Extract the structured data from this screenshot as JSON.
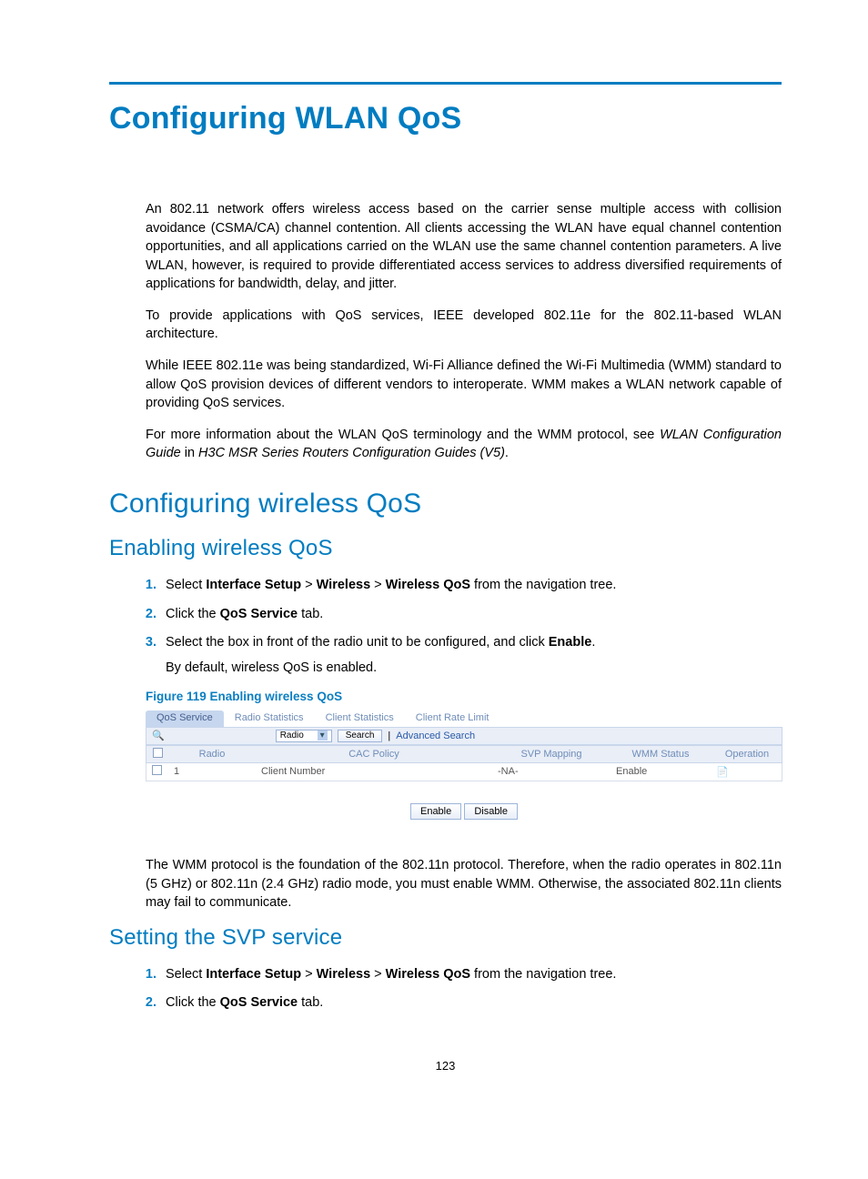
{
  "title": "Configuring WLAN QoS",
  "paragraphs": {
    "p1": "An 802.11 network offers wireless access based on the carrier sense multiple access with collision avoidance (CSMA/CA) channel contention. All clients accessing the WLAN have equal channel contention opportunities, and all applications carried on the WLAN use the same channel contention parameters. A live WLAN, however, is required to provide differentiated access services to address diversified requirements of applications for bandwidth, delay, and jitter.",
    "p2": "To provide applications with QoS services, IEEE developed 802.11e for the 802.11-based WLAN architecture.",
    "p3": "While IEEE 802.11e was being standardized, Wi-Fi Alliance defined the Wi-Fi Multimedia (WMM) standard to allow QoS provision devices of different vendors to interoperate. WMM makes a WLAN network capable of providing QoS services.",
    "p4a": "For more information about the WLAN QoS terminology and the WMM protocol, see ",
    "p4b": "WLAN Configuration Guide",
    "p4c": " in ",
    "p4d": "H3C MSR Series Routers Configuration Guides (V5)",
    "p4e": "."
  },
  "sections": {
    "config_wireless_qos": "Configuring wireless QoS",
    "enable_wireless_qos": "Enabling wireless QoS",
    "setting_svp": "Setting the SVP service"
  },
  "steps_enable": {
    "s1a": "Select ",
    "s1b": "Interface Setup",
    "s1c": " > ",
    "s1d": "Wireless",
    "s1e": " > ",
    "s1f": "Wireless QoS",
    "s1g": " from the navigation tree.",
    "s2a": "Click the ",
    "s2b": "QoS Service",
    "s2c": " tab.",
    "s3a": "Select the box in front of the radio unit to be configured, and click ",
    "s3b": "Enable",
    "s3c": ".",
    "s3_body": "By default, wireless QoS is enabled."
  },
  "figure_caption": "Figure 119 Enabling wireless QoS",
  "screenshot": {
    "tabs": [
      "QoS Service",
      "Radio Statistics",
      "Client Statistics",
      "Client Rate Limit"
    ],
    "search": {
      "field_value": "Radio",
      "button": "Search",
      "advanced": "Advanced Search"
    },
    "columns": [
      "",
      "Radio",
      "CAC Policy",
      "SVP Mapping",
      "WMM Status",
      "Operation"
    ],
    "row": {
      "radio": "1",
      "cac": "Client Number",
      "svp": "-NA-",
      "wmm": "Enable"
    },
    "buttons": {
      "enable": "Enable",
      "disable": "Disable"
    }
  },
  "post_figure_note": "The WMM protocol is the foundation of the 802.11n protocol. Therefore, when the radio operates in 802.11n (5 GHz) or 802.11n (2.4 GHz) radio mode, you must enable WMM. Otherwise, the associated 802.11n clients may fail to communicate.",
  "steps_svp": {
    "s1a": "Select ",
    "s1b": "Interface Setup",
    "s1c": " > ",
    "s1d": "Wireless",
    "s1e": " > ",
    "s1f": "Wireless QoS",
    "s1g": " from the navigation tree.",
    "s2a": "Click the ",
    "s2b": "QoS Service",
    "s2c": " tab."
  },
  "page_number": "123"
}
